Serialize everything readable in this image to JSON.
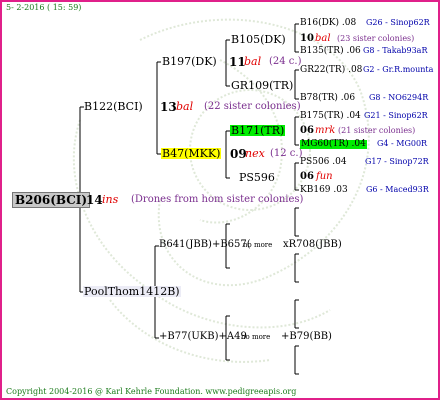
{
  "header": {
    "date_label": "5-  2-2016 ( 15: 59)"
  },
  "root": {
    "name": "B206(BCI)",
    "number": "14",
    "type": "ins",
    "note": "(Drones from hom sister colonies)"
  },
  "paternal": {
    "name": "B122(BCI)",
    "number": "13",
    "type": "bal",
    "note": "(22 sister colonies)",
    "upper": {
      "name": "B197(DK)",
      "number": "11",
      "type": "bal",
      "note": "(24 c.)",
      "top": {
        "name": "B105(DK)",
        "number": "10",
        "type": "bal",
        "note": "(23 sister colonies)"
      },
      "bottom": {
        "name": "GR109(TR)"
      }
    },
    "lower": {
      "name": "B47(MKK)",
      "number": "09",
      "type": "nex",
      "note": "(12 c.)",
      "top": {
        "name": "B171(TR)",
        "number": "06",
        "type": "mrk",
        "note": "(21 sister colonies)"
      },
      "bottom": {
        "name": "PS596",
        "number": "06",
        "type": "fun"
      }
    }
  },
  "leaf_column": [
    {
      "name": "B16(DK) .08",
      "right": "G26 - Sinop62R"
    },
    {
      "name": "B135(TR) .06",
      "right": "G8 - Takab93aR"
    },
    {
      "name": "GR22(TR) .08",
      "right": "G2 - Gr.R.mounta"
    },
    {
      "name": "B78(TR) .06",
      "right": "G8 - NO6294R"
    },
    {
      "name": "B175(TR) .04",
      "right": "G21 - Sinop62R"
    },
    {
      "name": "MG60(TR) .04",
      "right": "G4 - MG00R"
    },
    {
      "name": "PS506 .04",
      "right": "G17 - Sinop72R"
    },
    {
      "name": "KB169 .03",
      "right": "G6 - Maced93R"
    }
  ],
  "maternal": {
    "name": "PoolThom1412B)",
    "upper_line": {
      "left": "B641(JBB)+B657(",
      "mid": "no more",
      "right": "xR708(JBB)"
    },
    "lower_line": {
      "left": "+B77(UKB)+A49",
      "mid": "no more",
      "right": "+B79(BB)"
    }
  },
  "footer": {
    "text": "Copyright 2004-2016 @ Karl Kehrle Foundation.   www.pedigreeapis.org"
  },
  "colors": {
    "frame": "#e0208a",
    "highlight_yellow": "#ffff00",
    "highlight_green": "#00ee00",
    "type_red": "#e00000",
    "note_purple": "#7a2e8e",
    "right_blue": "#0000aa",
    "footer_green": "#1a7a1a"
  }
}
